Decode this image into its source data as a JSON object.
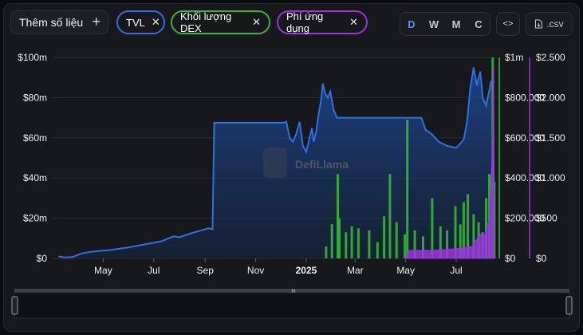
{
  "toolbar": {
    "add_metric_label": "Thêm số liệu",
    "plus_icon": "plus-icon",
    "chips": [
      {
        "label": "TVL",
        "color": "#2f6fe0"
      },
      {
        "label": "Khối lượng DEX",
        "color": "#35b53a"
      },
      {
        "label": "Phí ứng dụng",
        "color": "#9b34e0"
      }
    ],
    "periods": [
      "D",
      "W",
      "M",
      "C"
    ],
    "active_period": "D",
    "embed_label": "<>",
    "csv_label": ".csv"
  },
  "watermark": "DefiLlama",
  "chart_data": {
    "type": "area",
    "x_tick_labels": [
      "May",
      "Jul",
      "Sep",
      "Nov",
      "2025",
      "Mar",
      "May",
      "Jul"
    ],
    "axes": {
      "tvl": {
        "ticks": [
          "$0",
          "$20m",
          "$40m",
          "$60m",
          "$80m",
          "$100m"
        ],
        "ylim": [
          0,
          100000000
        ]
      },
      "dex_volume": {
        "ticks": [
          "$0",
          "$200.000",
          "$400.000",
          "$600.000",
          "$800.000",
          "$1m"
        ],
        "ylim": [
          0,
          1000000
        ]
      },
      "fees": {
        "ticks": [
          "$0",
          "$500",
          "$1.000",
          "$1.500",
          "$2.000",
          "$2.500"
        ],
        "ylim": [
          0,
          2500
        ]
      }
    },
    "series": [
      {
        "name": "TVL",
        "type": "area",
        "color": "#2f6fe0",
        "points": [
          [
            "2024-03-08",
            1000000
          ],
          [
            "2024-03-15",
            500000
          ],
          [
            "2024-03-25",
            700000
          ],
          [
            "2024-04-05",
            2500000
          ],
          [
            "2024-04-20",
            3500000
          ],
          [
            "2024-05-10",
            4200000
          ],
          [
            "2024-06-01",
            5500000
          ],
          [
            "2024-06-20",
            7000000
          ],
          [
            "2024-07-10",
            8500000
          ],
          [
            "2024-07-25",
            11000000
          ],
          [
            "2024-08-01",
            10500000
          ],
          [
            "2024-08-15",
            12500000
          ],
          [
            "2024-08-28",
            14000000
          ],
          [
            "2024-09-05",
            15000000
          ],
          [
            "2024-09-10",
            14500000
          ],
          [
            "2024-09-12",
            67500000
          ],
          [
            "2024-12-05",
            67500000
          ],
          [
            "2024-12-08",
            68000000
          ],
          [
            "2024-12-12",
            60000000
          ],
          [
            "2024-12-16",
            58000000
          ],
          [
            "2024-12-20",
            62000000
          ],
          [
            "2024-12-24",
            68000000
          ],
          [
            "2024-12-28",
            56000000
          ],
          [
            "2025-01-01",
            53000000
          ],
          [
            "2025-01-05",
            60000000
          ],
          [
            "2025-01-08",
            65000000
          ],
          [
            "2025-01-10",
            58000000
          ],
          [
            "2025-01-13",
            63000000
          ],
          [
            "2025-01-16",
            72000000
          ],
          [
            "2025-01-19",
            79000000
          ],
          [
            "2025-01-21",
            87000000
          ],
          [
            "2025-01-24",
            82000000
          ],
          [
            "2025-01-27",
            80000000
          ],
          [
            "2025-01-30",
            83000000
          ],
          [
            "2025-02-03",
            74000000
          ],
          [
            "2025-02-07",
            70000000
          ],
          [
            "2025-03-15",
            70000000
          ],
          [
            "2025-04-15",
            70000000
          ],
          [
            "2025-05-05",
            70000000
          ],
          [
            "2025-05-20",
            70000000
          ],
          [
            "2025-05-25",
            64000000
          ],
          [
            "2025-06-01",
            62000000
          ],
          [
            "2025-06-10",
            58000000
          ],
          [
            "2025-06-20",
            56000000
          ],
          [
            "2025-07-01",
            55000000
          ],
          [
            "2025-07-10",
            59000000
          ],
          [
            "2025-07-14",
            68000000
          ],
          [
            "2025-07-18",
            85000000
          ],
          [
            "2025-07-22",
            95000000
          ],
          [
            "2025-07-26",
            86000000
          ],
          [
            "2025-07-30",
            93000000
          ],
          [
            "2025-08-02",
            80000000
          ],
          [
            "2025-08-06",
            76000000
          ],
          [
            "2025-08-09",
            82000000
          ],
          [
            "2025-08-12",
            88000000
          ],
          [
            "2025-08-16",
            88000000
          ]
        ]
      },
      {
        "name": "Khối lượng DEX",
        "type": "bar",
        "color": "#35b53a",
        "points": [
          [
            "2025-01-25",
            60000
          ],
          [
            "2025-02-01",
            170000
          ],
          [
            "2025-02-08",
            420000
          ],
          [
            "2025-02-10",
            200000
          ],
          [
            "2025-02-18",
            130000
          ],
          [
            "2025-02-25",
            160000
          ],
          [
            "2025-03-05",
            150000
          ],
          [
            "2025-03-18",
            140000
          ],
          [
            "2025-03-28",
            80000
          ],
          [
            "2025-04-05",
            210000
          ],
          [
            "2025-04-12",
            420000
          ],
          [
            "2025-04-20",
            180000
          ],
          [
            "2025-04-30",
            120000
          ],
          [
            "2025-05-03",
            690000
          ],
          [
            "2025-05-12",
            140000
          ],
          [
            "2025-05-22",
            110000
          ],
          [
            "2025-06-02",
            300000
          ],
          [
            "2025-06-12",
            160000
          ],
          [
            "2025-06-20",
            140000
          ],
          [
            "2025-06-30",
            260000
          ],
          [
            "2025-07-06",
            170000
          ],
          [
            "2025-07-10",
            280000
          ],
          [
            "2025-07-15",
            320000
          ],
          [
            "2025-07-22",
            220000
          ],
          [
            "2025-07-28",
            180000
          ],
          [
            "2025-08-02",
            130000
          ],
          [
            "2025-08-06",
            300000
          ],
          [
            "2025-08-10",
            420000
          ],
          [
            "2025-08-14",
            1000000
          ],
          [
            "2025-08-16",
            380000
          ]
        ]
      },
      {
        "name": "Phí ứng dụng",
        "type": "area",
        "color": "#9b34e0",
        "points": [
          [
            "2025-05-01",
            0
          ],
          [
            "2025-05-05",
            100
          ],
          [
            "2025-06-01",
            100
          ],
          [
            "2025-07-01",
            120
          ],
          [
            "2025-07-20",
            150
          ],
          [
            "2025-07-30",
            300
          ],
          [
            "2025-08-05",
            300
          ],
          [
            "2025-08-10",
            500
          ],
          [
            "2025-08-13",
            1200
          ],
          [
            "2025-08-15",
            2400
          ],
          [
            "2025-08-16",
            800
          ]
        ]
      }
    ]
  }
}
